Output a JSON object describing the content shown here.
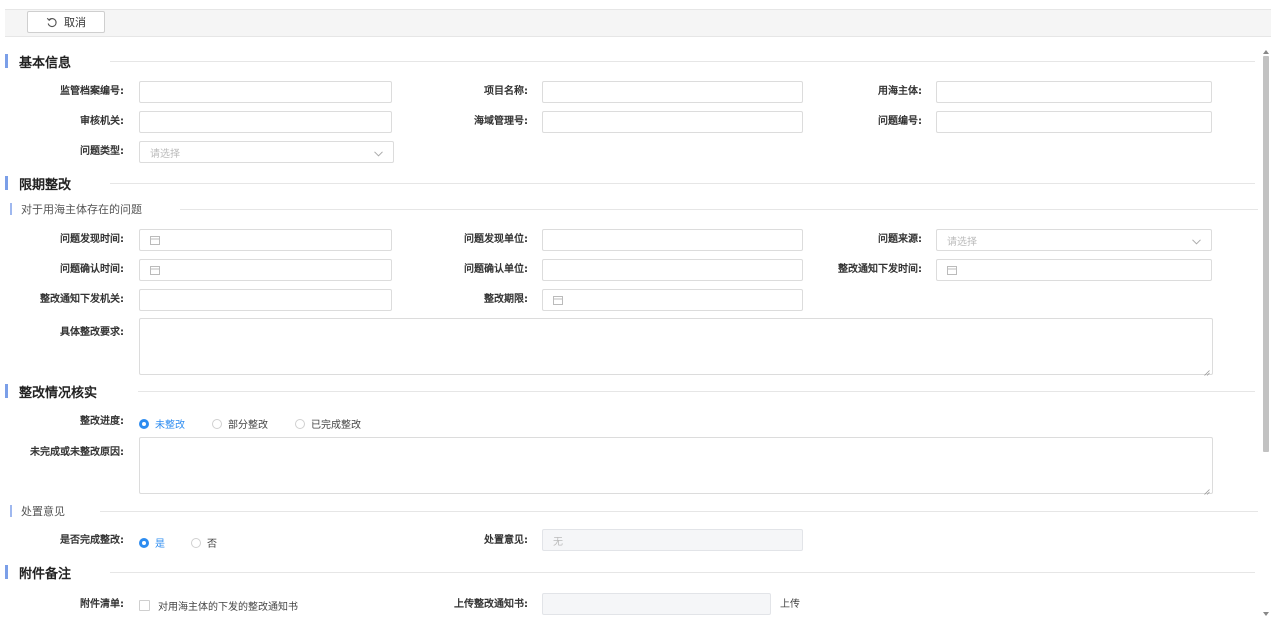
{
  "toolbar": {
    "cancel_label": "取消"
  },
  "sections": {
    "basic": "基本信息",
    "rectify": "限期整改",
    "rectify_sub": "对于用海主体存在的问题",
    "verify": "整改情况核实",
    "disposal_sub": "处置意见",
    "attach": "附件备注"
  },
  "basic": {
    "archive_no_label": "监管档案编号:",
    "project_name_label": "项目名称:",
    "sea_user_label": "用海主体:",
    "review_org_label": "审核机关:",
    "sea_mgmt_no_label": "海域管理号:",
    "problem_no_label": "问题编号:",
    "problem_type_label": "问题类型:",
    "problem_type_placeholder": "请选择"
  },
  "rectify": {
    "found_time_label": "问题发现时间:",
    "found_unit_label": "问题发现单位:",
    "source_label": "问题来源:",
    "source_placeholder": "请选择",
    "confirm_time_label": "问题确认时间:",
    "confirm_unit_label": "问题确认单位:",
    "notice_time_label": "整改通知下发时间:",
    "notice_org_label": "整改通知下发机关:",
    "deadline_label": "整改期限:",
    "requirement_label": "具体整改要求:"
  },
  "verify": {
    "progress_label": "整改进度:",
    "progress_options": [
      "未整改",
      "部分整改",
      "已完成整改"
    ],
    "progress_selected": 0,
    "reason_label": "未完成或未整改原因:",
    "completed_label": "是否完成整改:",
    "completed_options": [
      "是",
      "否"
    ],
    "completed_selected": 0,
    "opinion_label": "处置意见:",
    "opinion_value": "无"
  },
  "attach": {
    "list_label": "附件清单:",
    "list_item": "对用海主体的下发的整改通知书",
    "upload_label": "上传整改通知书:",
    "upload_button": "上传"
  }
}
